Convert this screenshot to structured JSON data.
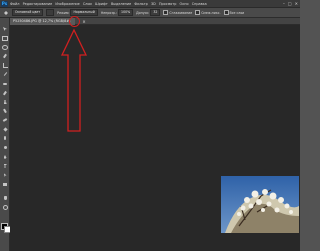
{
  "app": {
    "logo_text": "Ps"
  },
  "menu": [
    "Файл",
    "Редактирование",
    "Изображение",
    "Слои",
    "Шрифт",
    "Выделение",
    "Фильтр",
    "3D",
    "Просмотр",
    "Окно",
    "Справка"
  ],
  "window_controls": {
    "minimize": "–",
    "maximize": "□",
    "close": "✕"
  },
  "options": {
    "brush_preset": "Основной цвет",
    "mode_label": "Режим:",
    "mode_value": "Нормальный",
    "opacity_label": "Непрозр.:",
    "opacity_value": "100%",
    "tolerance_label": "Допуск:",
    "tolerance_value": "32",
    "antialias_label": "Сглаживание",
    "contiguous_label": "Смеж.пикс.",
    "all_layers_label": "Все слои"
  },
  "document_tab": {
    "title": "P5250486.JPG @ 12,7% (RGB/8#)",
    "close_icon": "×"
  },
  "colors": {
    "menubar": "#3a3a3a",
    "options_bar": "#4a4a4a",
    "canvas": "#282828",
    "annotation_red": "#d02020",
    "photo_sky": "#3d6fb0"
  },
  "icons": [
    "photoshop-logo-icon",
    "move-tool-icon",
    "marquee-tool-icon",
    "lasso-tool-icon",
    "quick-select-tool-icon",
    "crop-tool-icon",
    "eyedropper-tool-icon",
    "healing-tool-icon",
    "brush-tool-icon",
    "stamp-tool-icon",
    "history-brush-icon",
    "eraser-tool-icon",
    "paint-bucket-icon",
    "blur-tool-icon",
    "dodge-tool-icon",
    "pen-tool-icon",
    "type-tool-icon",
    "path-select-icon",
    "shape-tool-icon",
    "hand-tool-icon",
    "zoom-tool-icon",
    "close-icon",
    "red-arrow-annotation"
  ]
}
